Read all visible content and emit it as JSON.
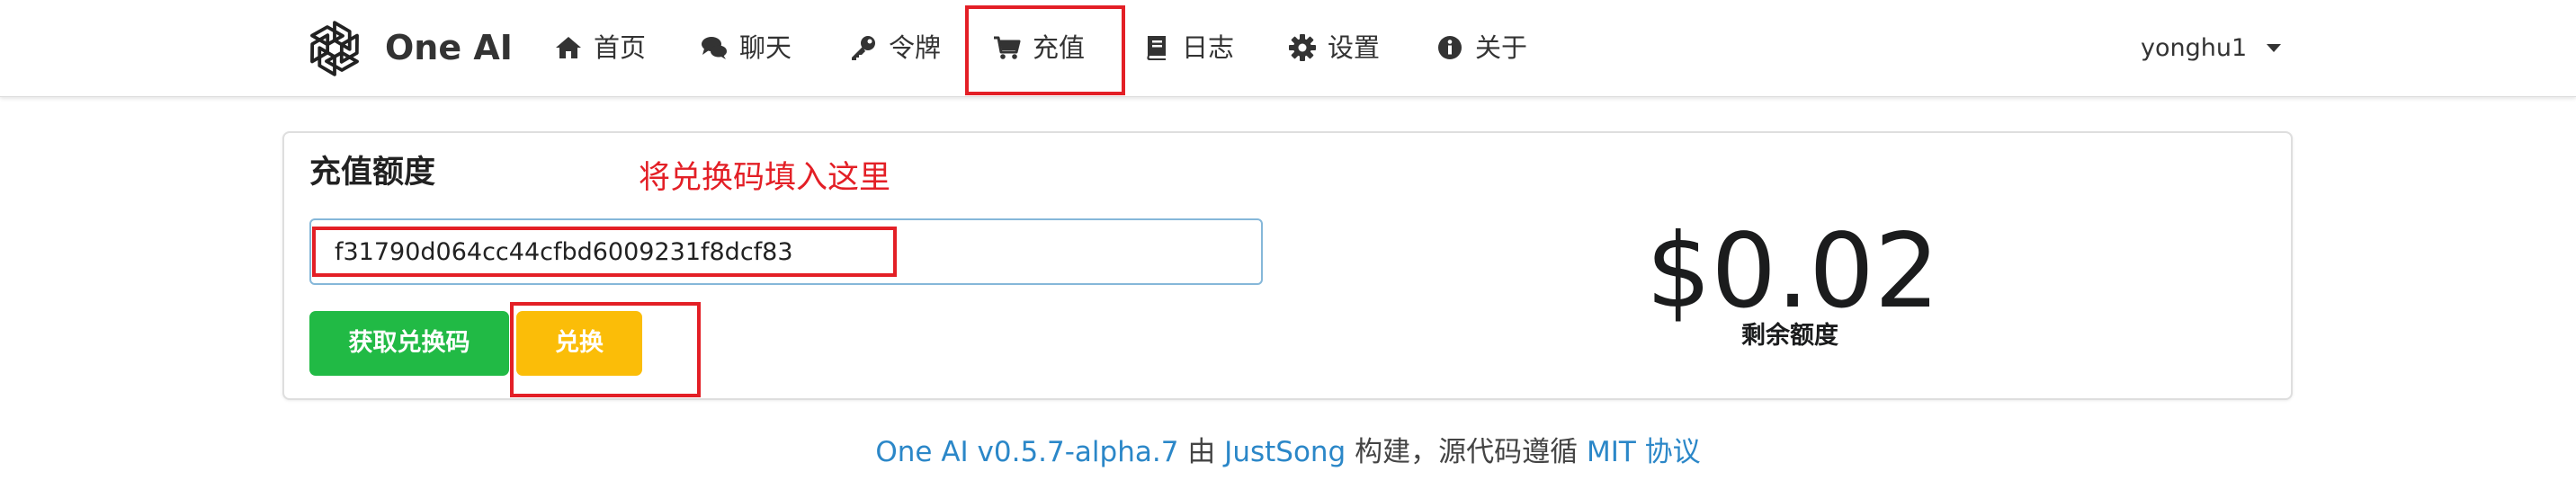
{
  "brand": {
    "name": "One AI",
    "logo_icon": "openai-logo-icon"
  },
  "nav": [
    {
      "label": "首页",
      "icon": "home-icon"
    },
    {
      "label": "聊天",
      "icon": "chat-icon"
    },
    {
      "label": "令牌",
      "icon": "key-icon"
    },
    {
      "label": "充值",
      "icon": "cart-icon",
      "highlighted": true
    },
    {
      "label": "日志",
      "icon": "book-icon"
    },
    {
      "label": "设置",
      "icon": "gear-icon"
    },
    {
      "label": "关于",
      "icon": "info-icon"
    }
  ],
  "user": {
    "name": "yonghu1",
    "icon": "caret-down-icon"
  },
  "topup": {
    "title": "充值额度",
    "annotation": "将兑换码填入这里",
    "redeem_code": "f31790d064cc44cfbd6009231f8dcf83",
    "get_code_label": "获取兑换码",
    "redeem_label": "兑换"
  },
  "balance": {
    "value": "$0.02",
    "label": "剩余额度"
  },
  "footer": {
    "app_version": "One AI v0.5.7-alpha.7",
    "by": "由",
    "author": "JustSong",
    "built_text": "构建，源代码遵循",
    "license": "MIT 协议"
  },
  "colors": {
    "annotation_red": "#e31f26",
    "green_button": "#21ba45",
    "yellow_button": "#fbbd08",
    "link_blue": "#2b87c8",
    "input_border_focus": "#85b7d9"
  }
}
